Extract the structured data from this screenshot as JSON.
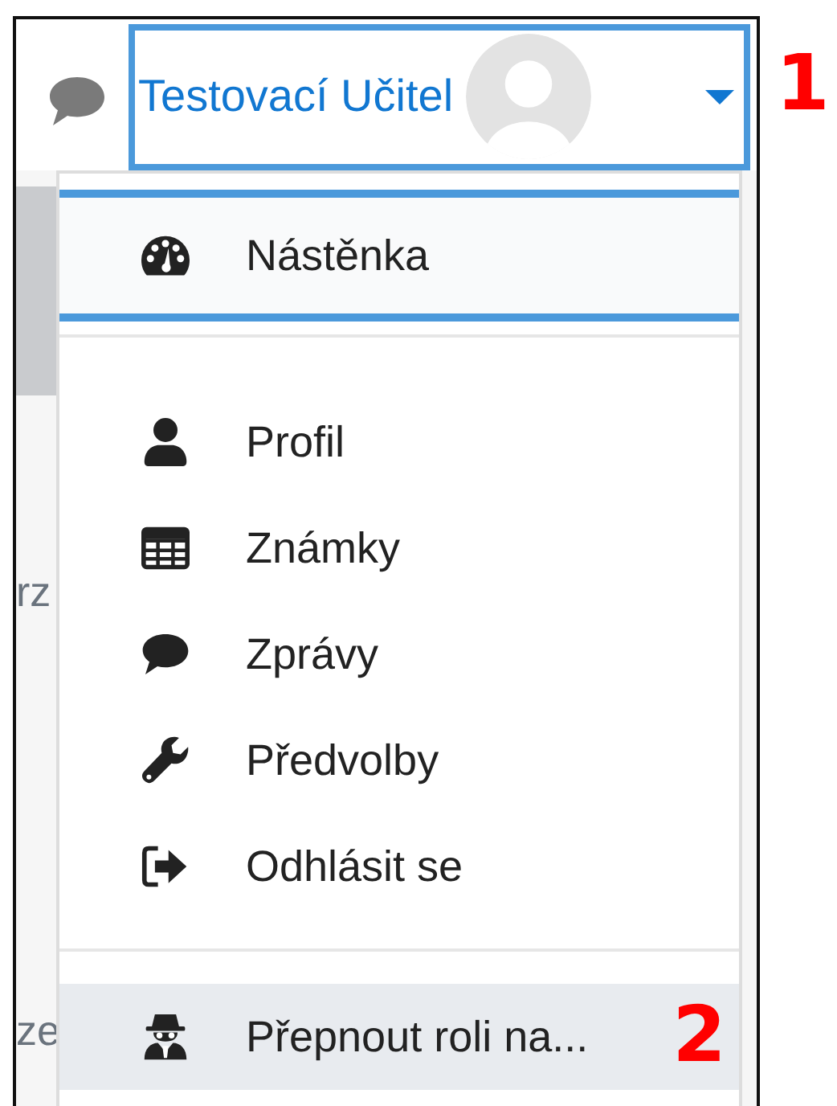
{
  "header": {
    "user_name": "Testovací Učitel",
    "menu_open": true,
    "focused": true
  },
  "background_texts": [
    "rz",
    "ze"
  ],
  "menu": {
    "groups": [
      [
        {
          "label": "Nástěnka",
          "kind": "gauge",
          "selected": true,
          "hovered": false
        }
      ],
      [
        {
          "label": "Profil",
          "kind": "user",
          "selected": false,
          "hovered": false
        },
        {
          "label": "Známky",
          "kind": "table",
          "selected": false,
          "hovered": false
        },
        {
          "label": "Zprávy",
          "kind": "comment",
          "selected": false,
          "hovered": false
        },
        {
          "label": "Předvolby",
          "kind": "wrench",
          "selected": false,
          "hovered": false
        },
        {
          "label": "Odhlásit se",
          "kind": "signout",
          "selected": false,
          "hovered": false
        }
      ],
      [
        {
          "label": "Přepnout roli na...",
          "kind": "spy",
          "selected": false,
          "hovered": true
        }
      ]
    ]
  },
  "annotations": [
    "1",
    "2"
  ]
}
